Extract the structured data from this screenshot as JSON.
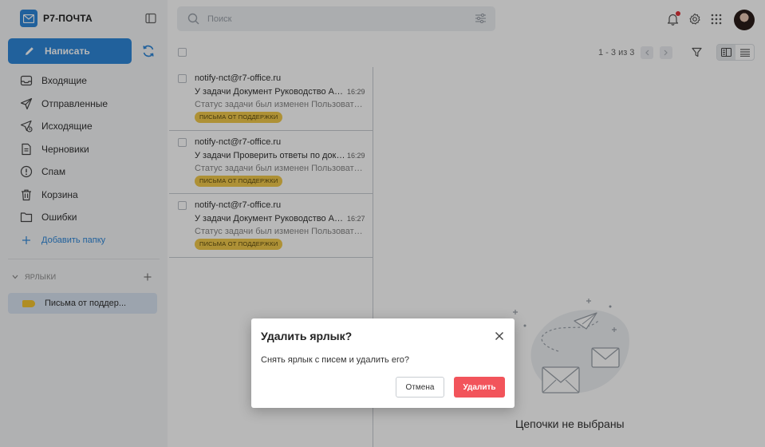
{
  "app": {
    "title": "Р7-ПОЧТА"
  },
  "sidebar": {
    "compose_label": "Написать",
    "items": [
      {
        "label": "Входящие",
        "icon": "inbox-icon"
      },
      {
        "label": "Отправленные",
        "icon": "send-icon"
      },
      {
        "label": "Исходящие",
        "icon": "outbox-icon"
      },
      {
        "label": "Черновики",
        "icon": "draft-icon"
      },
      {
        "label": "Спам",
        "icon": "spam-icon"
      },
      {
        "label": "Корзина",
        "icon": "trash-icon"
      },
      {
        "label": "Ошибки",
        "icon": "folder-icon"
      }
    ],
    "add_folder_label": "Добавить папку",
    "labels_header": "ЯРЛЫКИ",
    "labels": [
      {
        "label": "Письма от поддер...",
        "color": "#f4c430"
      }
    ]
  },
  "search": {
    "placeholder": "Поиск"
  },
  "toolbar": {
    "pager_text": "1 - 3 из 3"
  },
  "messages": [
    {
      "from": "notify-nct@r7-office.ru",
      "subject": "У задачи Документ Руководство Адм...",
      "time": "16:29",
      "preview": "Статус задачи был изменен Пользовател...",
      "tag": "ПИСЬМА ОТ ПОДДЕРЖКИ"
    },
    {
      "from": "notify-nct@r7-office.ru",
      "subject": "У задачи Проверить ответы по доку...",
      "time": "16:29",
      "preview": "Статус задачи был изменен Пользовател...",
      "tag": "ПИСЬМА ОТ ПОДДЕРЖКИ"
    },
    {
      "from": "notify-nct@r7-office.ru",
      "subject": "У задачи Документ Руководство Ад...",
      "time": "16:27",
      "preview": "Статус задачи был изменен Пользовател...",
      "tag": "ПИСЬМА ОТ ПОДДЕРЖКИ"
    }
  ],
  "empty_state": {
    "text": "Цепочки не выбраны"
  },
  "dialog": {
    "title": "Удалить ярлык?",
    "body": "Снять ярлык с писем и удалить его?",
    "cancel_label": "Отмена",
    "delete_label": "Удалить"
  },
  "colors": {
    "accent": "#2f87d8",
    "danger": "#f2545b",
    "tag": "#f2c94c"
  }
}
